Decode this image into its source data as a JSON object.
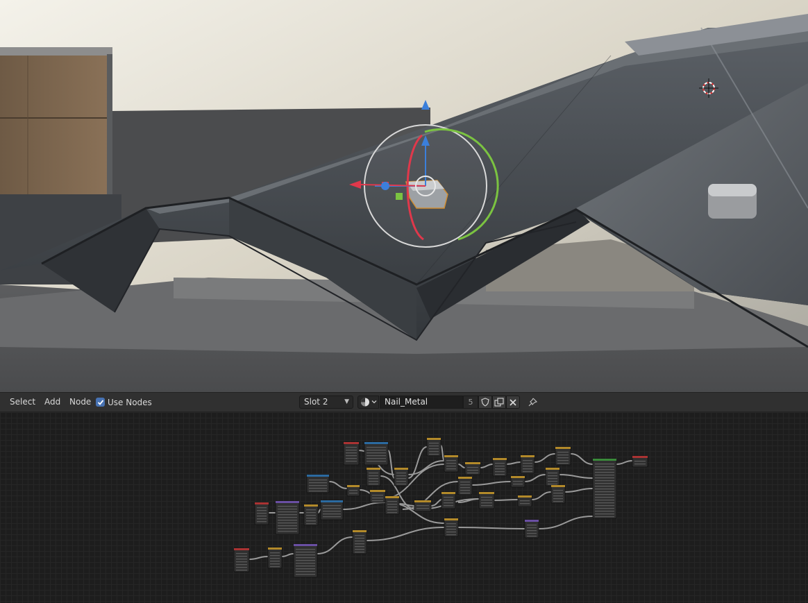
{
  "header": {
    "menus": [
      "Select",
      "Add",
      "Node"
    ],
    "use_nodes_label": "Use Nodes",
    "use_nodes_checked": true,
    "slot_label": "Slot 2",
    "material_name": "Nail_Metal",
    "material_users": "5"
  },
  "icons": {
    "material_type": "material-sphere-icon",
    "fake_user": "shield-icon",
    "duplicate": "duplicate-icon",
    "unlink": "close-icon",
    "pin": "pin-icon"
  },
  "colors": {
    "header_bg": "#303030",
    "checkbox_blue": "#4772b3",
    "gizmo_x": "#e0384b",
    "gizmo_y": "#7bc341",
    "gizmo_z": "#3b7fdb"
  }
}
